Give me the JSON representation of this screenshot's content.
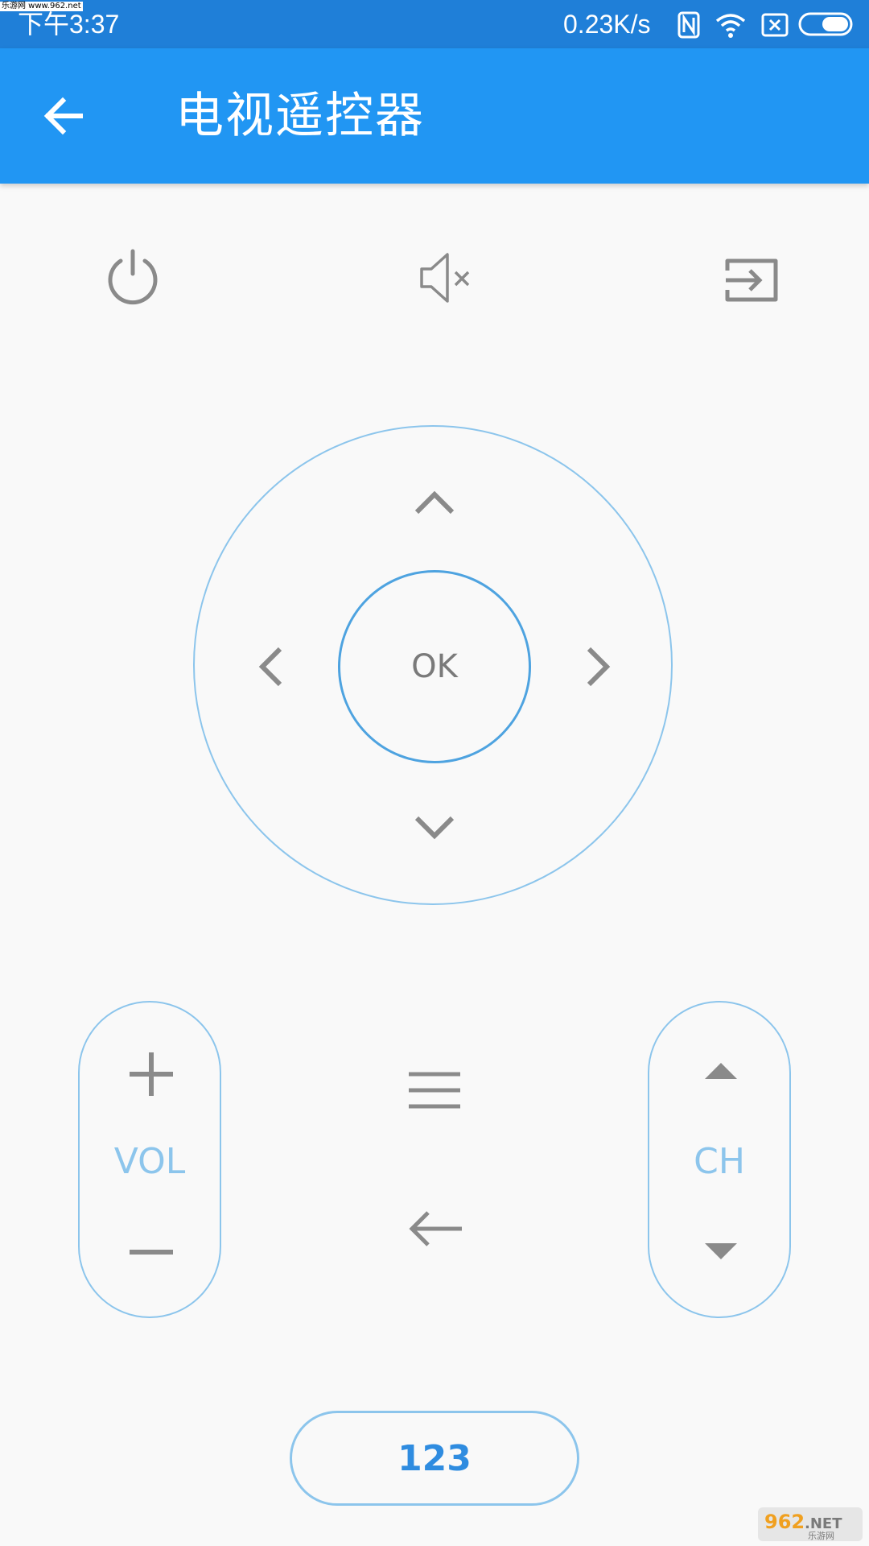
{
  "statusbar": {
    "watermark_small": "乐游网 www.962.net",
    "time": "下午3:37",
    "speed": "0.23K/s"
  },
  "appbar": {
    "title": "电视遥控器"
  },
  "remote": {
    "ok_label": "OK",
    "vol_label": "VOL",
    "ch_label": "CH",
    "num_label": "123"
  },
  "watermark": {
    "brand": "962.NET",
    "sub": "乐游网"
  },
  "colors": {
    "statusbar": "#1f7fd8",
    "appbar": "#2196f3",
    "ring": "#8cc5ec",
    "icon_gray": "#8a8a8a"
  }
}
